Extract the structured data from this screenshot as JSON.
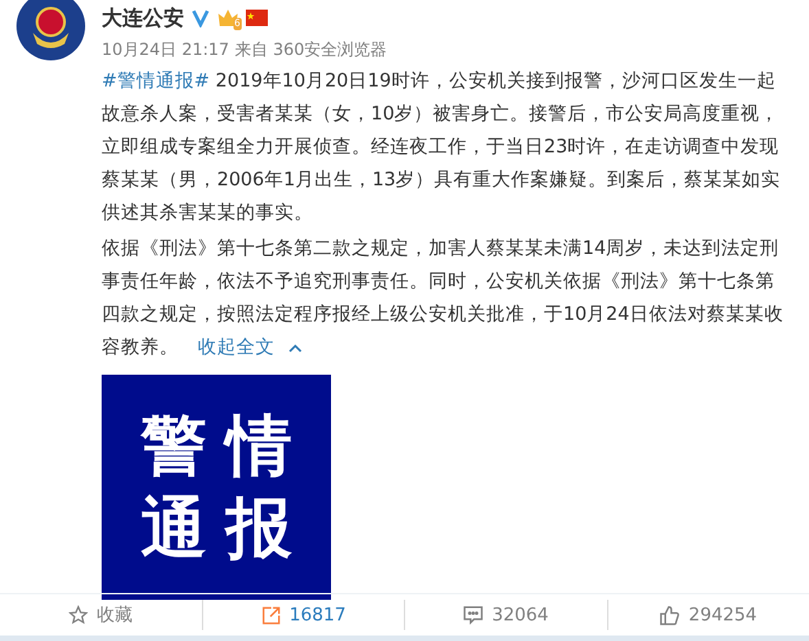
{
  "post": {
    "author": "大连公安",
    "verified": true,
    "member_level": "6",
    "time": "10月24日 21:17",
    "source": "来自 360安全浏览器",
    "paragraphs": [
      {
        "topic": "#警情通报#",
        "text": " 2019年10月20日19时许，公安机关接到报警，沙河口区发生一起故意杀人案，受害者某某（女，10岁）被害身亡。接警后，市公安局高度重视，立即组成专案组全力开展侦查。经连夜工作，于当日23时许，在走访调查中发现蔡某某（男，2006年1月出生，13岁）具有重大作案嫌疑。到案后，蔡某某如实供述其杀害某某的事实。"
      },
      {
        "text": "依据《刑法》第十七条第二款之规定，加害人蔡某某未满14周岁，未达到法定刑事责任年龄，依法不予追究刑事责任。同时，公安机关依据《刑法》第十七条第四款之规定，按照法定程序报经上级公安机关批准，于10月24日依法对蔡某某收容教养。",
        "collapse_link": "收起全文"
      }
    ],
    "image": {
      "lines": [
        "警情",
        "通报"
      ]
    }
  },
  "actions": [
    {
      "kind": "favorite",
      "label": "收藏",
      "active": false
    },
    {
      "kind": "repost",
      "label": "16817",
      "active": true
    },
    {
      "kind": "comment",
      "label": "32064",
      "active": false
    },
    {
      "kind": "like",
      "label": "294254",
      "active": false
    }
  ]
}
